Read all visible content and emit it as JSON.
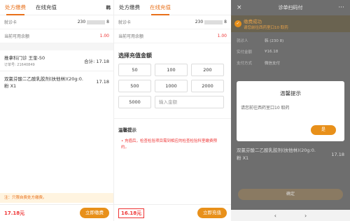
{
  "panel1": {
    "tabs": [
      "处方缴费",
      "在线充值"
    ],
    "tab_extra": "韩",
    "card_label": "就诊卡",
    "card_value_prefix": "230",
    "card_value_suffix": "8",
    "balance_label": "当前可用余额",
    "balance_value": "1.00",
    "prescription": {
      "title": "推拿科门诊  王奎-50",
      "order": "订单号: 21640849",
      "total_label": "合计:",
      "total_value": "17.18"
    },
    "drug": {
      "name": "双氯芬酸二乙胺乳胶剂(扶他林)(20g:0.",
      "qty": "粉 X1",
      "price": "17.18"
    },
    "notice": "注：只限自费处方缴费。",
    "amount": "17.18元",
    "pay_button": "立即缴费"
  },
  "panel2": {
    "tabs": [
      "处方缴费",
      "在线充值"
    ],
    "card_label": "就诊卡",
    "card_value_prefix": "230",
    "card_value_suffix": "8",
    "balance_label": "当前可用余额",
    "balance_value": "1.00",
    "section_title": "选择充值金额",
    "amounts": [
      "50",
      "100",
      "200",
      "500",
      "1000",
      "2000",
      "5000"
    ],
    "custom_placeholder": "输入金额",
    "tips_title": "温馨提示",
    "tips_text": "充值后，检查检验项目需到相应的检查检验科室缴费预约。",
    "amount": "16.18元",
    "recharge_button": "立即充值"
  },
  "panel3": {
    "header_title": "诊单扫码付",
    "close_icon": "×",
    "more_icon": "···",
    "success_title": "缴费成功",
    "success_sub": "请您前往西药室口10 取药",
    "rows": [
      {
        "k": "就诊人",
        "v": "韩     (230              8)"
      },
      {
        "k": "实付金额",
        "v": "¥16.18"
      },
      {
        "k": "支付方式",
        "v": "微信支付"
      }
    ],
    "modal": {
      "title": "温馨提示",
      "body": "请您前往西药室口10 取药",
      "ok": "是"
    },
    "drug_name": "双氯芬酸二乙胺乳胶剂(扶他林)(20g:0.",
    "drug_qty": "粉 X1",
    "drug_price": "17.18",
    "confirm_button": "确定",
    "nav_back": "‹",
    "nav_forward": "›"
  }
}
